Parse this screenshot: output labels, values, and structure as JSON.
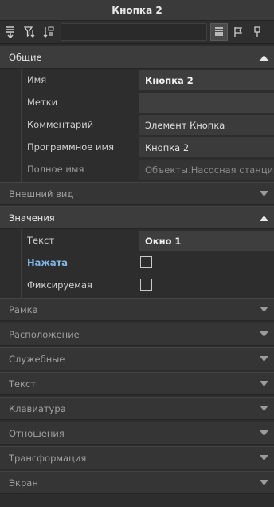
{
  "window": {
    "title": "Кнопка 2"
  },
  "toolbar": {
    "left_icons": [
      "sort-down-icon",
      "filter-icon",
      "sort-az-icon"
    ],
    "search_value": "",
    "right_icons": [
      "list-view-icon",
      "flag-icon",
      "pin-icon"
    ]
  },
  "sections": {
    "general": {
      "label": "Общие",
      "expanded": true,
      "rows": [
        {
          "label": "Имя",
          "value": "Кнопка 2"
        },
        {
          "label": "Метки",
          "value": ""
        },
        {
          "label": "Комментарий",
          "value": "Элемент Кнопка"
        },
        {
          "label": "Программное имя",
          "value": "Кнопка 2"
        },
        {
          "label": "Полное имя",
          "value": "Объекты.Насосная станция.К"
        }
      ]
    },
    "appearance": {
      "label": "Внешний вид",
      "expanded": false
    },
    "values": {
      "label": "Значения",
      "expanded": true,
      "rows": [
        {
          "label": "Текст",
          "value": "Окно 1"
        },
        {
          "label": "Нажата",
          "checked": false
        },
        {
          "label": "Фиксируемая",
          "checked": false
        }
      ]
    },
    "frame": {
      "label": "Рамка",
      "expanded": false
    },
    "layout": {
      "label": "Расположение",
      "expanded": false
    },
    "service": {
      "label": "Служебные",
      "expanded": false
    },
    "text": {
      "label": "Текст",
      "expanded": false
    },
    "keyboard": {
      "label": "Клавиатура",
      "expanded": false
    },
    "relations": {
      "label": "Отношения",
      "expanded": false
    },
    "transform": {
      "label": "Трансформация",
      "expanded": false
    },
    "screen": {
      "label": "Экран",
      "expanded": false
    }
  },
  "colors": {
    "link": "#7fb8e8",
    "background": "#2d2d2d"
  }
}
